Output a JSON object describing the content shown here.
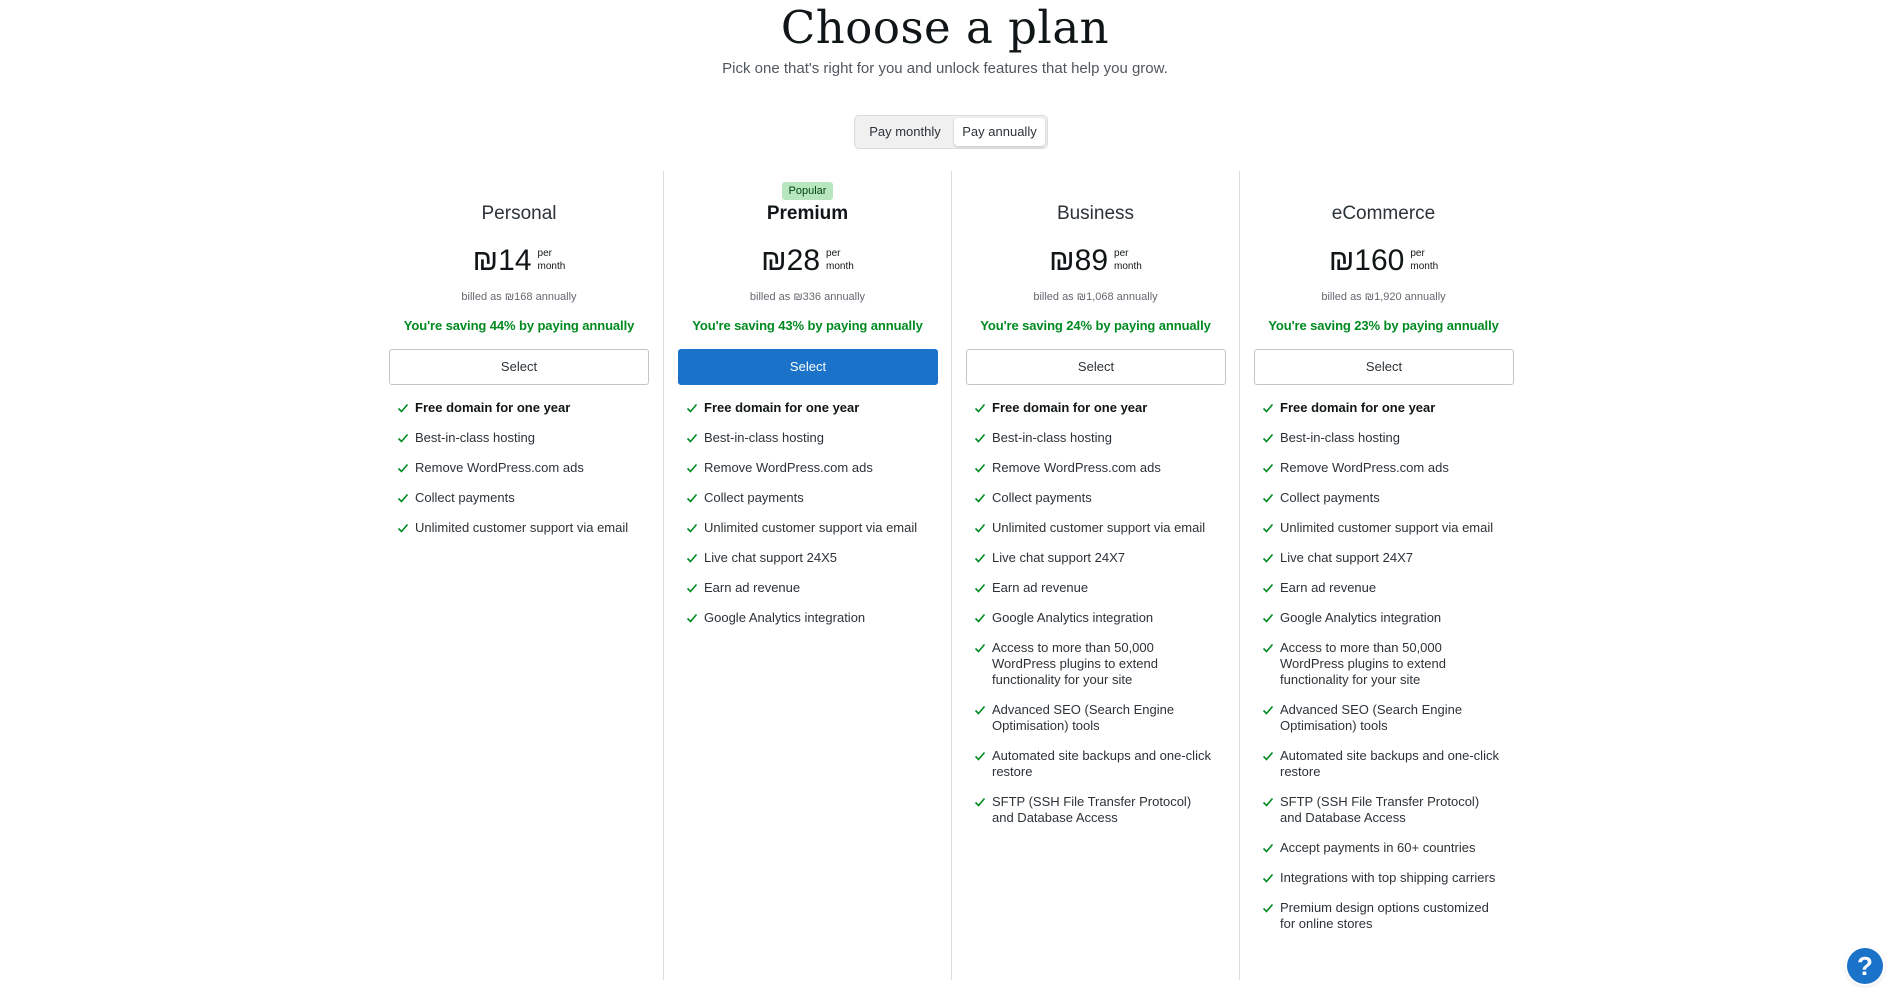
{
  "header": {
    "title": "Choose a plan",
    "subtitle": "Pick one that's right for you and unlock features that help you grow."
  },
  "billing_toggle": {
    "monthly_label": "Pay monthly",
    "annual_label": "Pay annually",
    "selected": "annual"
  },
  "plans": [
    {
      "name": "Personal",
      "badge": "",
      "price": "₪14",
      "per_1": "per",
      "per_2": "month",
      "billed": "billed as ₪168 annually",
      "saving": "You're saving 44% by paying annually",
      "select_label": "Select",
      "features": [
        "Free domain for one year",
        "Best-in-class hosting",
        "Remove WordPress.com ads",
        "Collect payments",
        "Unlimited customer support via email"
      ]
    },
    {
      "name": "Premium",
      "badge": "Popular",
      "price": "₪28",
      "per_1": "per",
      "per_2": "month",
      "billed": "billed as ₪336 annually",
      "saving": "You're saving 43% by paying annually",
      "select_label": "Select",
      "features": [
        "Free domain for one year",
        "Best-in-class hosting",
        "Remove WordPress.com ads",
        "Collect payments",
        "Unlimited customer support via email",
        "Live chat support 24X5",
        "Earn ad revenue",
        "Google Analytics integration"
      ]
    },
    {
      "name": "Business",
      "badge": "",
      "price": "₪89",
      "per_1": "per",
      "per_2": "month",
      "billed": "billed as ₪1,068 annually",
      "saving": "You're saving 24% by paying annually",
      "select_label": "Select",
      "features": [
        "Free domain for one year",
        "Best-in-class hosting",
        "Remove WordPress.com ads",
        "Collect payments",
        "Unlimited customer support via email",
        "Live chat support 24X7",
        "Earn ad revenue",
        "Google Analytics integration",
        "Access to more than 50,000 WordPress plugins to extend functionality for your site",
        "Advanced SEO (Search Engine Optimisation) tools",
        "Automated site backups and one-click restore",
        "SFTP (SSH File Transfer Protocol) and Database Access"
      ]
    },
    {
      "name": "eCommerce",
      "badge": "",
      "price": "₪160",
      "per_1": "per",
      "per_2": "month",
      "billed": "billed as ₪1,920 annually",
      "saving": "You're saving 23% by paying annually",
      "select_label": "Select",
      "features": [
        "Free domain for one year",
        "Best-in-class hosting",
        "Remove WordPress.com ads",
        "Collect payments",
        "Unlimited customer support via email",
        "Live chat support 24X7",
        "Earn ad revenue",
        "Google Analytics integration",
        "Access to more than 50,000 WordPress plugins to extend functionality for your site",
        "Advanced SEO (Search Engine Optimisation) tools",
        "Automated site backups and one-click restore",
        "SFTP (SSH File Transfer Protocol) and Database Access",
        "Accept payments in 60+ countries",
        "Integrations with top shipping carriers",
        "Premium design options customized for online stores"
      ]
    }
  ],
  "help_button": {
    "label": "?"
  },
  "colors": {
    "accent": "#1a73c8",
    "saving_green": "#008a20",
    "badge_bg": "#b8e6bf",
    "check_green": "#008a20"
  },
  "icons": {
    "feature_check": "checkmark-icon",
    "help": "help-icon"
  }
}
